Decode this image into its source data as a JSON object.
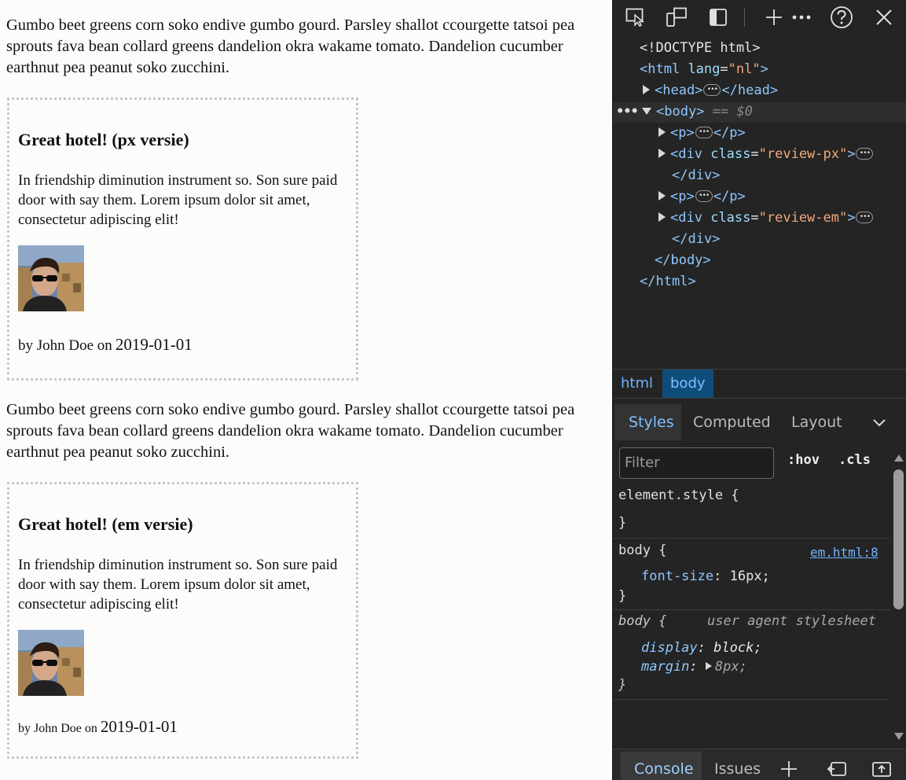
{
  "page": {
    "paragraph_1": "Gumbo beet greens corn soko endive gumbo gourd. Parsley shallot ccourgette tatsoi pea sprouts fava bean collard greens dandelion okra wakame tomato. Dandelion cucumber earthnut pea peanut soko zucchini.",
    "review_px": {
      "title": "Great hotel! (px versie)",
      "text": "In friendship diminution instrument so. Son sure paid door with say them. Lorem ipsum dolor sit amet, consectetur adipiscing elit!",
      "by": "by John Doe on",
      "date": "2019-01-01"
    },
    "paragraph_2": "Gumbo beet greens corn soko endive gumbo gourd. Parsley shallot ccourgette tatsoi pea sprouts fava bean collard greens dandelion okra wakame tomato. Dandelion cucumber earthnut pea peanut soko zucchini.",
    "review_em": {
      "title": "Great hotel! (em versie)",
      "text": "In friendship diminution instrument so. Son sure paid door with say them. Lorem ipsum dolor sit amet, consectetur adipiscing elit!",
      "by": "by John Doe on",
      "date": "2019-01-01"
    }
  },
  "devtools": {
    "toolbar_icons": [
      "inspect-element-icon",
      "device-emulation-icon",
      "sidebar-icon",
      "add-tab-icon",
      "more-icon",
      "help-icon",
      "close-icon"
    ],
    "dom": {
      "doctype": "<!DOCTYPE html>",
      "html_open": "<html",
      "lang_attr": "lang",
      "lang_val": "\"nl\"",
      "gt": ">",
      "head_open": "<head>",
      "head_close": "</head>",
      "body_open": "<body>",
      "selected_marker": "== $0",
      "p_open": "<p>",
      "p_close": "</p>",
      "div_open": "<div",
      "class_attr": "class",
      "class_px": "\"review-px\"",
      "class_em": "\"review-em\"",
      "div_close": "</div>",
      "body_close": "</body>",
      "html_close": "</html>"
    },
    "breadcrumbs": [
      "html",
      "body"
    ],
    "tabs": [
      "Styles",
      "Computed",
      "Layout"
    ],
    "filter_placeholder": "Filter",
    "hov": ":hov",
    "cls": ".cls",
    "rules": {
      "element_style": "element.style {",
      "close_brace": "}",
      "body_selector": "body {",
      "body_source": "em.html:8",
      "font_size_prop": "font-size",
      "font_size_val": "16px;",
      "ua_selector": "body {",
      "ua_source": "user agent stylesheet",
      "display_prop": "display",
      "display_val": "block;",
      "margin_prop": "margin",
      "margin_val": "8px;"
    },
    "drawer_tabs": [
      "Console",
      "Issues"
    ],
    "colors": {
      "panel_bg": "#242424",
      "accent": "#6fb3ff",
      "selected_crumb": "#0e4d7a"
    }
  }
}
